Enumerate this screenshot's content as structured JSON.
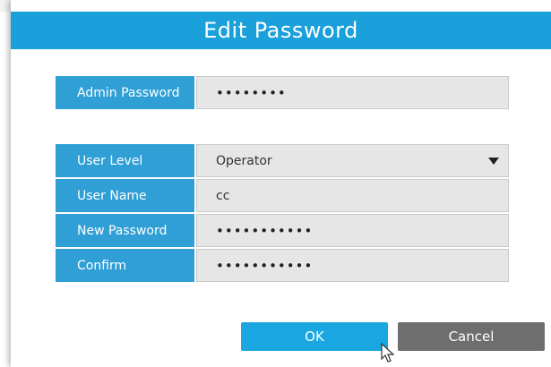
{
  "dialog": {
    "title": "Edit Password",
    "admin_password": {
      "label": "Admin Password",
      "value": "••••••••"
    },
    "user_level": {
      "label": "User Level",
      "value": "Operator"
    },
    "user_name": {
      "label": "User Name",
      "value": "cc"
    },
    "new_password": {
      "label": "New Password",
      "value": "•••••••••••"
    },
    "confirm": {
      "label": "Confirm",
      "value": "•••••••••••"
    },
    "ok_label": "OK",
    "cancel_label": "Cancel"
  },
  "icons": {
    "dropdown": "chevron-down-icon",
    "cursor": "mouse-pointer-icon"
  },
  "colors": {
    "title_bar": "#1aa0da",
    "label_bg": "#2f9fd6",
    "ok_button": "#1aa6e0",
    "cancel_button": "#6e6e6e",
    "field_bg": "#e6e6e6"
  }
}
